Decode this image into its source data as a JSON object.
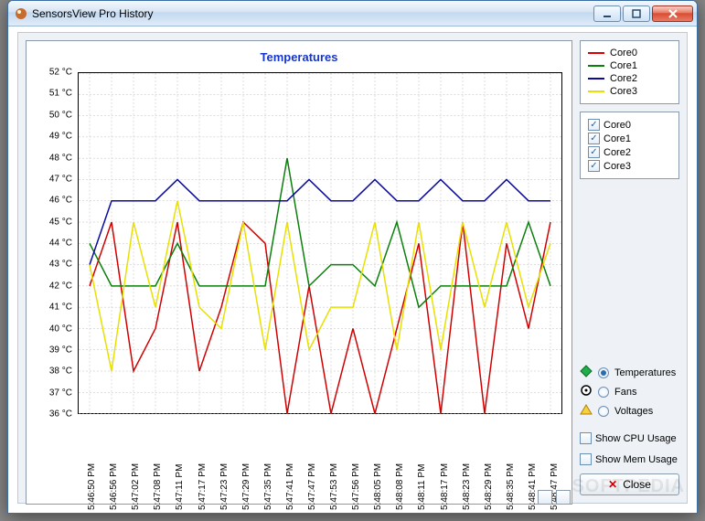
{
  "window": {
    "title": "SensorsView Pro History"
  },
  "chart_data": {
    "type": "line",
    "title": "Temperatures",
    "ylabel": "",
    "xlabel": "",
    "ylim": [
      36,
      52
    ],
    "y_unit": "°C",
    "categories": [
      "5:46:50 PM",
      "5:46:56 PM",
      "5:47:02 PM",
      "5:47:08 PM",
      "5:47:11 PM",
      "5:47:17 PM",
      "5:47:23 PM",
      "5:47:29 PM",
      "5:47:35 PM",
      "5:47:41 PM",
      "5:47:47 PM",
      "5:47:53 PM",
      "5:47:56 PM",
      "5:48:05 PM",
      "5:48:08 PM",
      "5:48:11 PM",
      "5:48:17 PM",
      "5:48:23 PM",
      "5:48:29 PM",
      "5:48:35 PM",
      "5:48:41 PM",
      "5:48:47 PM"
    ],
    "series": [
      {
        "name": "Core0",
        "color": "#d00000",
        "values": [
          42,
          45,
          38,
          40,
          45,
          38,
          41,
          45,
          44,
          36,
          42,
          36,
          40,
          36,
          40,
          44,
          36,
          45,
          36,
          44,
          40,
          45
        ]
      },
      {
        "name": "Core1",
        "color": "#0a7f0a",
        "values": [
          44,
          42,
          42,
          42,
          44,
          42,
          42,
          42,
          42,
          48,
          42,
          43,
          43,
          42,
          45,
          41,
          42,
          42,
          42,
          42,
          45,
          42
        ]
      },
      {
        "name": "Core2",
        "color": "#0a0aa0",
        "values": [
          43,
          46,
          46,
          46,
          47,
          46,
          46,
          46,
          46,
          46,
          47,
          46,
          46,
          47,
          46,
          46,
          47,
          46,
          46,
          47,
          46,
          46
        ]
      },
      {
        "name": "Core3",
        "color": "#e8e000",
        "values": [
          43,
          38,
          45,
          41,
          46,
          41,
          40,
          45,
          39,
          45,
          39,
          41,
          41,
          45,
          39,
          45,
          39,
          45,
          41,
          45,
          41,
          44
        ]
      }
    ]
  },
  "legend": {
    "items": [
      {
        "label": "Core0",
        "color": "red"
      },
      {
        "label": "Core1",
        "color": "green"
      },
      {
        "label": "Core2",
        "color": "navy"
      },
      {
        "label": "Core3",
        "color": "yellow"
      }
    ]
  },
  "checkboxes": {
    "items": [
      {
        "label": "Core0",
        "checked": true
      },
      {
        "label": "Core1",
        "checked": true
      },
      {
        "label": "Core2",
        "checked": true
      },
      {
        "label": "Core3",
        "checked": true
      }
    ]
  },
  "radios": {
    "items": [
      {
        "label": "Temperatures",
        "selected": true,
        "icon": "diamond-green"
      },
      {
        "label": "Fans",
        "selected": false,
        "icon": "circle-outline"
      },
      {
        "label": "Voltages",
        "selected": false,
        "icon": "triangle-yellow"
      }
    ]
  },
  "options": {
    "show_cpu": {
      "label": "Show CPU Usage",
      "checked": false
    },
    "show_mem": {
      "label": "Show Mem Usage",
      "checked": false
    }
  },
  "buttons": {
    "close": "Close"
  },
  "watermark": "SOFTPEDIA"
}
